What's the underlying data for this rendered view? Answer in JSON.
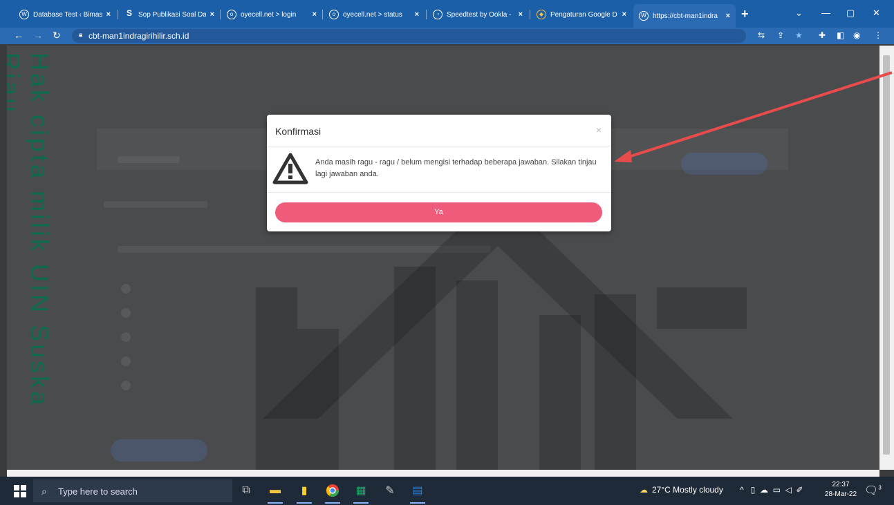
{
  "browser": {
    "tabs": [
      {
        "title": "Database Test ‹ Bimas",
        "icon": "wordpress-icon",
        "active": false
      },
      {
        "title": "Sop Publikasi Soal Da",
        "icon": "s-logo-icon",
        "active": false
      },
      {
        "title": "oyecell.net > login",
        "icon": "oyecell-icon",
        "active": false
      },
      {
        "title": "oyecell.net > status",
        "icon": "oyecell-icon",
        "active": false
      },
      {
        "title": "Speedtest by Ookla -",
        "icon": "speedtest-icon",
        "active": false
      },
      {
        "title": "Pengaturan Google D",
        "icon": "google-drive-icon",
        "active": false
      },
      {
        "title": "https://cbt-man1indra",
        "icon": "wordpress-icon",
        "active": true
      }
    ],
    "url": "cbt-man1indragirihilir.sch.id"
  },
  "page": {
    "watermark": "Hak cipta milik UIN Suska Riau"
  },
  "modal": {
    "title": "Konfirmasi",
    "close_symbol": "×",
    "message": "Anda masih ragu - ragu / belum mengisi terhadap beberapa jawaban. Silakan tinjau lagi jawaban anda.",
    "confirm_label": "Ya",
    "icon": "warning-icon",
    "accent_color": "#ef5b7a"
  },
  "taskbar": {
    "search_placeholder": "Type here to search",
    "weather": "27°C  Mostly cloudy",
    "time": "22:37",
    "date": "28-Mar-22",
    "notification_count": "3"
  }
}
